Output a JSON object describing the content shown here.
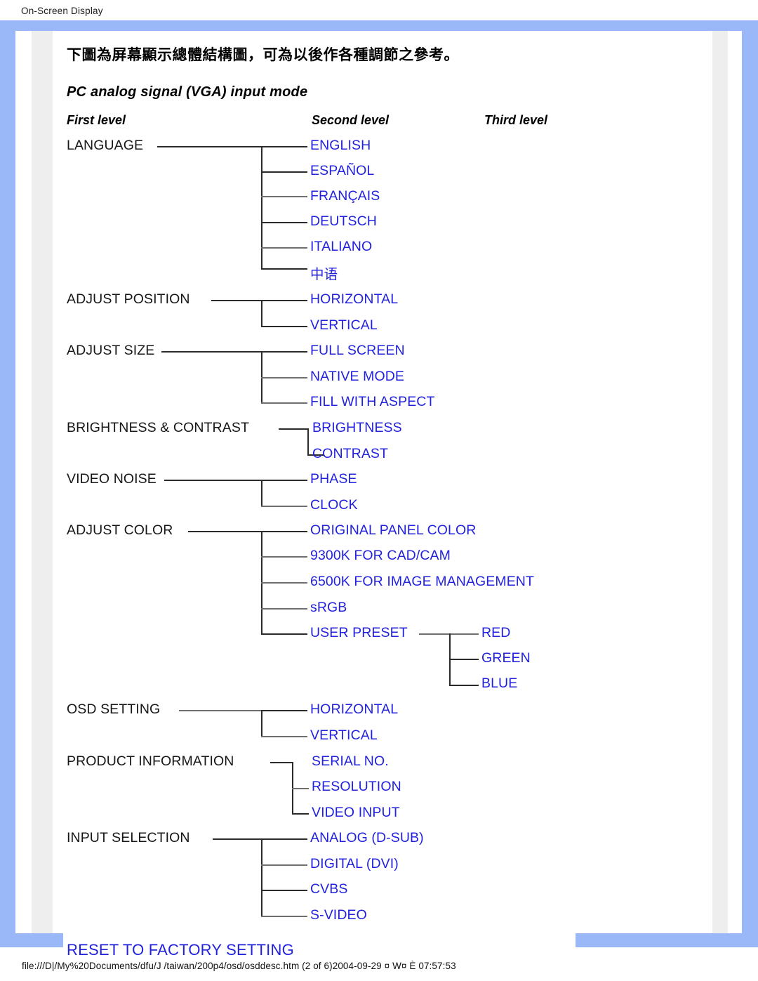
{
  "page": {
    "header": "On-Screen Display",
    "footer": "file:///D|/My%20Documents/dfu/J /taiwan/200p4/osd/osddesc.htm (2 of 6)2004-09-29 ¤ W¤ È 07:57:53",
    "intro": "下圖為屏幕顯示總體結構圖，可為以後作各種調節之參考。",
    "mode_title": "PC analog signal (VGA) input mode",
    "columns": {
      "first": "First level",
      "second": "Second level",
      "third": "Third level"
    },
    "colors": {
      "frame_blue": "#9ab7f8",
      "link_blue": "#2222dd",
      "text_black": "#171717",
      "rail_gray": "#eeeeee"
    }
  },
  "menu": {
    "items": [
      {
        "label": "LANGUAGE",
        "children": [
          {
            "label": "ENGLISH"
          },
          {
            "label": "ESPAÑOL"
          },
          {
            "label": "FRANÇAIS"
          },
          {
            "label": "DEUTSCH"
          },
          {
            "label": "ITALIANO"
          },
          {
            "label": "中语"
          }
        ]
      },
      {
        "label": "ADJUST POSITION",
        "children": [
          {
            "label": "HORIZONTAL"
          },
          {
            "label": "VERTICAL"
          }
        ]
      },
      {
        "label": "ADJUST SIZE",
        "children": [
          {
            "label": "FULL SCREEN"
          },
          {
            "label": "NATIVE MODE"
          },
          {
            "label": "FILL WITH ASPECT"
          }
        ]
      },
      {
        "label": "BRIGHTNESS & CONTRAST",
        "children": [
          {
            "label": "BRIGHTNESS"
          },
          {
            "label": "CONTRAST"
          }
        ]
      },
      {
        "label": "VIDEO NOISE",
        "children": [
          {
            "label": "PHASE"
          },
          {
            "label": "CLOCK"
          }
        ]
      },
      {
        "label": "ADJUST COLOR",
        "children": [
          {
            "label": "ORIGINAL PANEL COLOR"
          },
          {
            "label": "9300K FOR CAD/CAM"
          },
          {
            "label": "6500K FOR IMAGE MANAGEMENT"
          },
          {
            "label": "sRGB"
          },
          {
            "label": "USER PRESET",
            "children": [
              {
                "label": "RED"
              },
              {
                "label": "GREEN"
              },
              {
                "label": "BLUE"
              }
            ]
          }
        ]
      },
      {
        "label": "OSD SETTING",
        "children": [
          {
            "label": "HORIZONTAL"
          },
          {
            "label": "VERTICAL"
          }
        ]
      },
      {
        "label": "PRODUCT INFORMATION",
        "children": [
          {
            "label": "SERIAL NO."
          },
          {
            "label": "RESOLUTION"
          },
          {
            "label": "VIDEO INPUT"
          }
        ]
      },
      {
        "label": "INPUT SELECTION",
        "children": [
          {
            "label": "ANALOG (D-SUB)"
          },
          {
            "label": "DIGITAL (DVI)"
          },
          {
            "label": "CVBS"
          },
          {
            "label": "S-VIDEO"
          }
        ]
      },
      {
        "label": "RESET TO FACTORY SETTING",
        "children": []
      }
    ]
  }
}
